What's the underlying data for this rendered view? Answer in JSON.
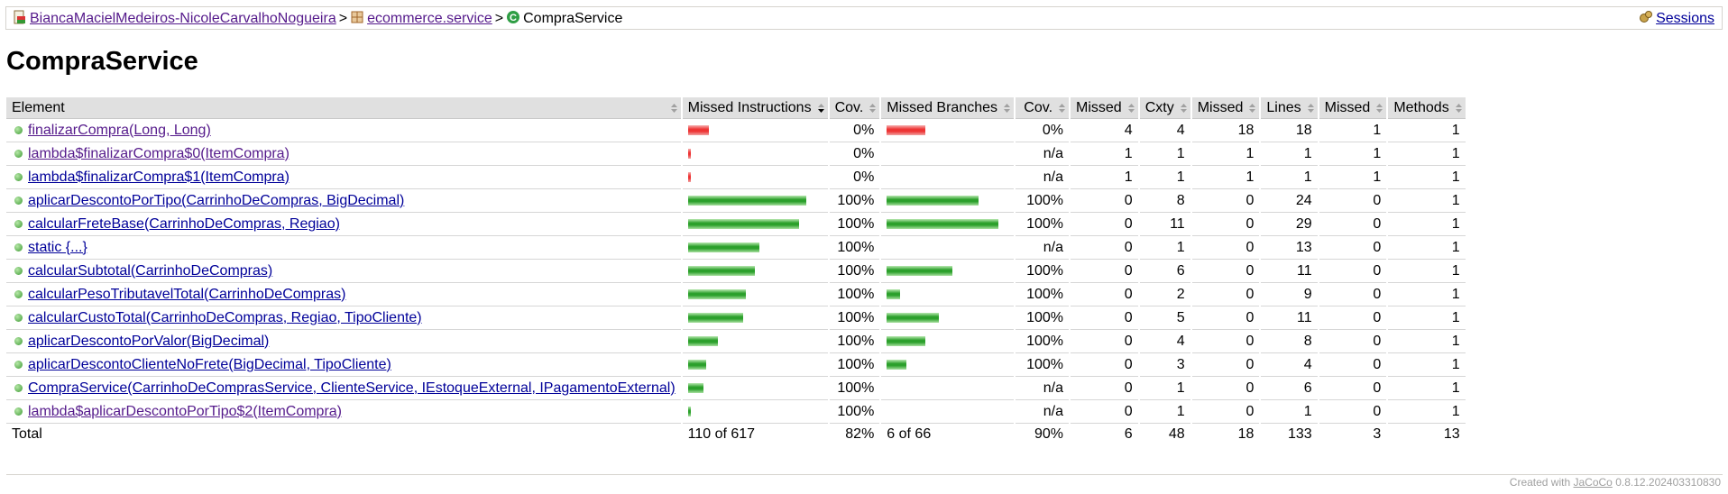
{
  "breadcrumb": {
    "items": [
      {
        "label": "BiancaMacielMedeiros-NicoleCarvalhoNogueira",
        "icon": "report-icon"
      },
      {
        "label": "ecommerce.service",
        "icon": "package-icon"
      },
      {
        "label": "CompraService",
        "icon": "class-icon"
      }
    ],
    "separator": ">",
    "sessions_label": "Sessions"
  },
  "page_title": "CompraService",
  "table": {
    "headers": [
      "Element",
      "Missed Instructions",
      "Cov.",
      "Missed Branches",
      "Cov.",
      "Missed",
      "Cxty",
      "Missed",
      "Lines",
      "Missed",
      "Methods"
    ],
    "rows": [
      {
        "name": "finalizarCompra(Long, Long)",
        "visited": true,
        "instr_missed_frac": 0.187,
        "instr_covered_frac": 0,
        "instr_cov": "0%",
        "br_missed_frac": 0.35,
        "br_covered_frac": 0,
        "br_cov": "0%",
        "cx_missed": "4",
        "cxty": "4",
        "ln_missed": "18",
        "lines": "18",
        "mt_missed": "1",
        "methods": "1"
      },
      {
        "name": "lambda$finalizarCompra$0(ItemCompra)",
        "visited": true,
        "instr_missed_frac": 0.005,
        "instr_covered_frac": 0,
        "instr_cov": "0%",
        "br_missed_frac": 0,
        "br_covered_frac": 0,
        "br_cov": "n/a",
        "cx_missed": "1",
        "cxty": "1",
        "ln_missed": "1",
        "lines": "1",
        "mt_missed": "1",
        "methods": "1"
      },
      {
        "name": "lambda$finalizarCompra$1(ItemCompra)",
        "visited": false,
        "instr_missed_frac": 0.005,
        "instr_covered_frac": 0,
        "instr_cov": "0%",
        "br_missed_frac": 0,
        "br_covered_frac": 0,
        "br_cov": "n/a",
        "cx_missed": "1",
        "cxty": "1",
        "ln_missed": "1",
        "lines": "1",
        "mt_missed": "1",
        "methods": "1"
      },
      {
        "name": "aplicarDescontoPorTipo(CarrinhoDeCompras, BigDecimal)",
        "visited": false,
        "instr_missed_frac": 0,
        "instr_covered_frac": 0.2,
        "instr_cov": "100%",
        "br_missed_frac": 0,
        "br_covered_frac": 0.82,
        "br_cov": "100%",
        "cx_missed": "0",
        "cxty": "8",
        "ln_missed": "0",
        "lines": "24",
        "mt_missed": "0",
        "methods": "1"
      },
      {
        "name": "calcularFreteBase(CarrinhoDeCompras, Regiao)",
        "visited": false,
        "instr_missed_frac": 0,
        "instr_covered_frac": 0.187,
        "instr_cov": "100%",
        "br_missed_frac": 0,
        "br_covered_frac": 1.0,
        "br_cov": "100%",
        "cx_missed": "0",
        "cxty": "11",
        "ln_missed": "0",
        "lines": "29",
        "mt_missed": "0",
        "methods": "1"
      },
      {
        "name": "static {...}",
        "visited": false,
        "instr_missed_frac": 0,
        "instr_covered_frac": 0.12,
        "instr_cov": "100%",
        "br_missed_frac": 0,
        "br_covered_frac": 0,
        "br_cov": "n/a",
        "cx_missed": "0",
        "cxty": "1",
        "ln_missed": "0",
        "lines": "13",
        "mt_missed": "0",
        "methods": "1"
      },
      {
        "name": "calcularSubtotal(CarrinhoDeCompras)",
        "visited": false,
        "instr_missed_frac": 0,
        "instr_covered_frac": 0.112,
        "instr_cov": "100%",
        "br_missed_frac": 0,
        "br_covered_frac": 0.59,
        "br_cov": "100%",
        "cx_missed": "0",
        "cxty": "6",
        "ln_missed": "0",
        "lines": "11",
        "mt_missed": "0",
        "methods": "1"
      },
      {
        "name": "calcularPesoTributavelTotal(CarrinhoDeCompras)",
        "visited": false,
        "instr_missed_frac": 0,
        "instr_covered_frac": 0.097,
        "instr_cov": "100%",
        "br_missed_frac": 0,
        "br_covered_frac": 0.12,
        "br_cov": "100%",
        "cx_missed": "0",
        "cxty": "2",
        "ln_missed": "0",
        "lines": "9",
        "mt_missed": "0",
        "methods": "1"
      },
      {
        "name": "calcularCustoTotal(CarrinhoDeCompras, Regiao, TipoCliente)",
        "visited": false,
        "instr_missed_frac": 0,
        "instr_covered_frac": 0.093,
        "instr_cov": "100%",
        "br_missed_frac": 0,
        "br_covered_frac": 0.47,
        "br_cov": "100%",
        "cx_missed": "0",
        "cxty": "5",
        "ln_missed": "0",
        "lines": "11",
        "mt_missed": "0",
        "methods": "1"
      },
      {
        "name": "aplicarDescontoPorValor(BigDecimal)",
        "visited": false,
        "instr_missed_frac": 0,
        "instr_covered_frac": 0.05,
        "instr_cov": "100%",
        "br_missed_frac": 0,
        "br_covered_frac": 0.35,
        "br_cov": "100%",
        "cx_missed": "0",
        "cxty": "4",
        "ln_missed": "0",
        "lines": "8",
        "mt_missed": "0",
        "methods": "1"
      },
      {
        "name": "aplicarDescontoClienteNoFrete(BigDecimal, TipoCliente)",
        "visited": false,
        "instr_missed_frac": 0,
        "instr_covered_frac": 0.03,
        "instr_cov": "100%",
        "br_missed_frac": 0,
        "br_covered_frac": 0.18,
        "br_cov": "100%",
        "cx_missed": "0",
        "cxty": "3",
        "ln_missed": "0",
        "lines": "4",
        "mt_missed": "0",
        "methods": "1"
      },
      {
        "name": "CompraService(CarrinhoDeComprasService, ClienteService, IEstoqueExternal, IPagamentoExternal)",
        "visited": false,
        "instr_missed_frac": 0,
        "instr_covered_frac": 0.026,
        "instr_cov": "100%",
        "br_missed_frac": 0,
        "br_covered_frac": 0,
        "br_cov": "n/a",
        "cx_missed": "0",
        "cxty": "1",
        "ln_missed": "0",
        "lines": "6",
        "mt_missed": "0",
        "methods": "1"
      },
      {
        "name": "lambda$aplicarDescontoPorTipo$2(ItemCompra)",
        "visited": true,
        "instr_missed_frac": 0,
        "instr_covered_frac": 0.005,
        "instr_cov": "100%",
        "br_missed_frac": 0,
        "br_covered_frac": 0,
        "br_cov": "n/a",
        "cx_missed": "0",
        "cxty": "1",
        "ln_missed": "0",
        "lines": "1",
        "mt_missed": "0",
        "methods": "1"
      }
    ],
    "total": {
      "label": "Total",
      "instr": "110 of 617",
      "instr_cov": "82%",
      "br": "6 of 66",
      "br_cov": "90%",
      "cx_missed": "6",
      "cxty": "48",
      "ln_missed": "18",
      "lines": "133",
      "mt_missed": "3",
      "methods": "13"
    }
  },
  "footer": {
    "prefix": "Created with",
    "link": "JaCoCo",
    "version": "0.8.12.202403310830"
  },
  "colors": {
    "missed": "#e33333",
    "covered": "#2ba02b",
    "link": "#000099",
    "visited": "#551a8b",
    "header_bg": "#e0e0e0"
  }
}
